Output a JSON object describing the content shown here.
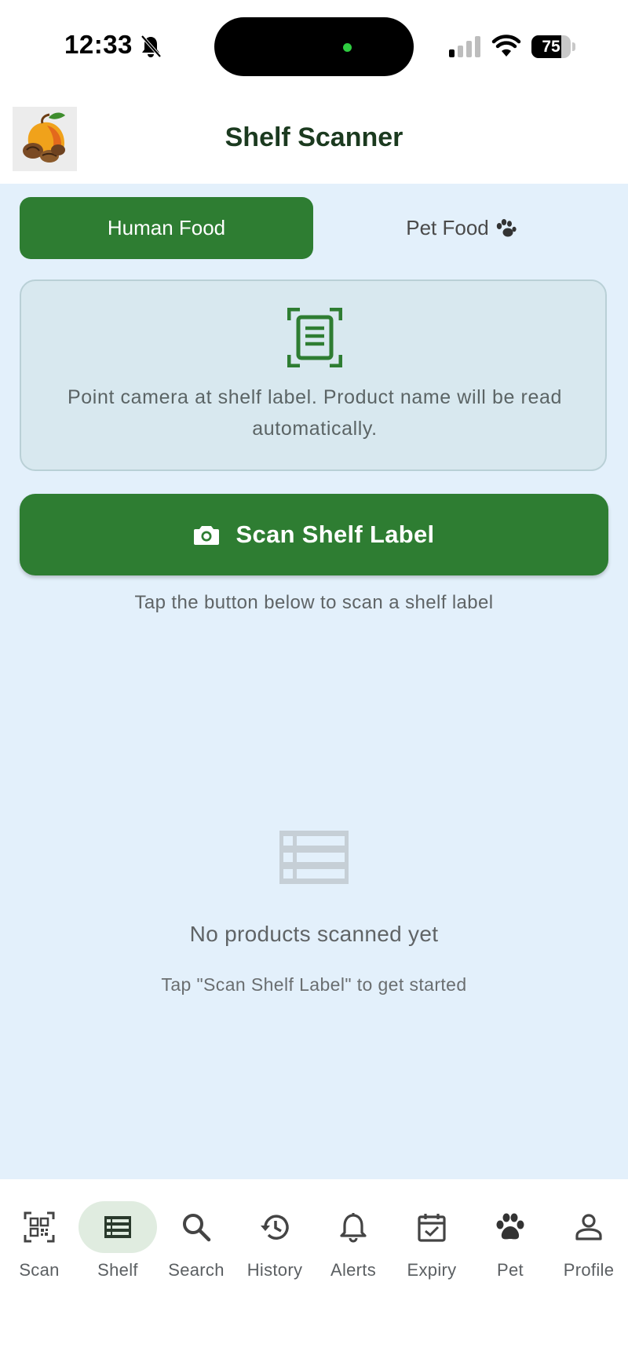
{
  "status_bar": {
    "time": "12:33",
    "battery": "75"
  },
  "app_bar": {
    "title": "Shelf Scanner"
  },
  "tabs": [
    {
      "label": "Human Food",
      "selected": true
    },
    {
      "label": "Pet Food",
      "selected": false
    }
  ],
  "info_card": {
    "text": "Point camera at shelf label. Product name will be read automatically."
  },
  "scan_button": {
    "label": "Scan Shelf Label"
  },
  "hint": "Tap the button below to scan a shelf label",
  "empty_state": {
    "title": "No products scanned yet",
    "subtitle": "Tap \"Scan Shelf Label\" to get started"
  },
  "nav": {
    "active": "Shelf",
    "items": [
      {
        "label": "Scan",
        "icon": "qr-scan-icon"
      },
      {
        "label": "Shelf",
        "icon": "list-icon"
      },
      {
        "label": "Search",
        "icon": "search-icon"
      },
      {
        "label": "History",
        "icon": "history-icon"
      },
      {
        "label": "Alerts",
        "icon": "bell-icon"
      },
      {
        "label": "Expiry",
        "icon": "calendar-check-icon"
      },
      {
        "label": "Pet",
        "icon": "paw-icon"
      },
      {
        "label": "Profile",
        "icon": "person-icon"
      }
    ]
  },
  "colors": {
    "primary": "#2e7d32",
    "background": "#e3f0fb",
    "title_text": "#1b3a1f"
  }
}
